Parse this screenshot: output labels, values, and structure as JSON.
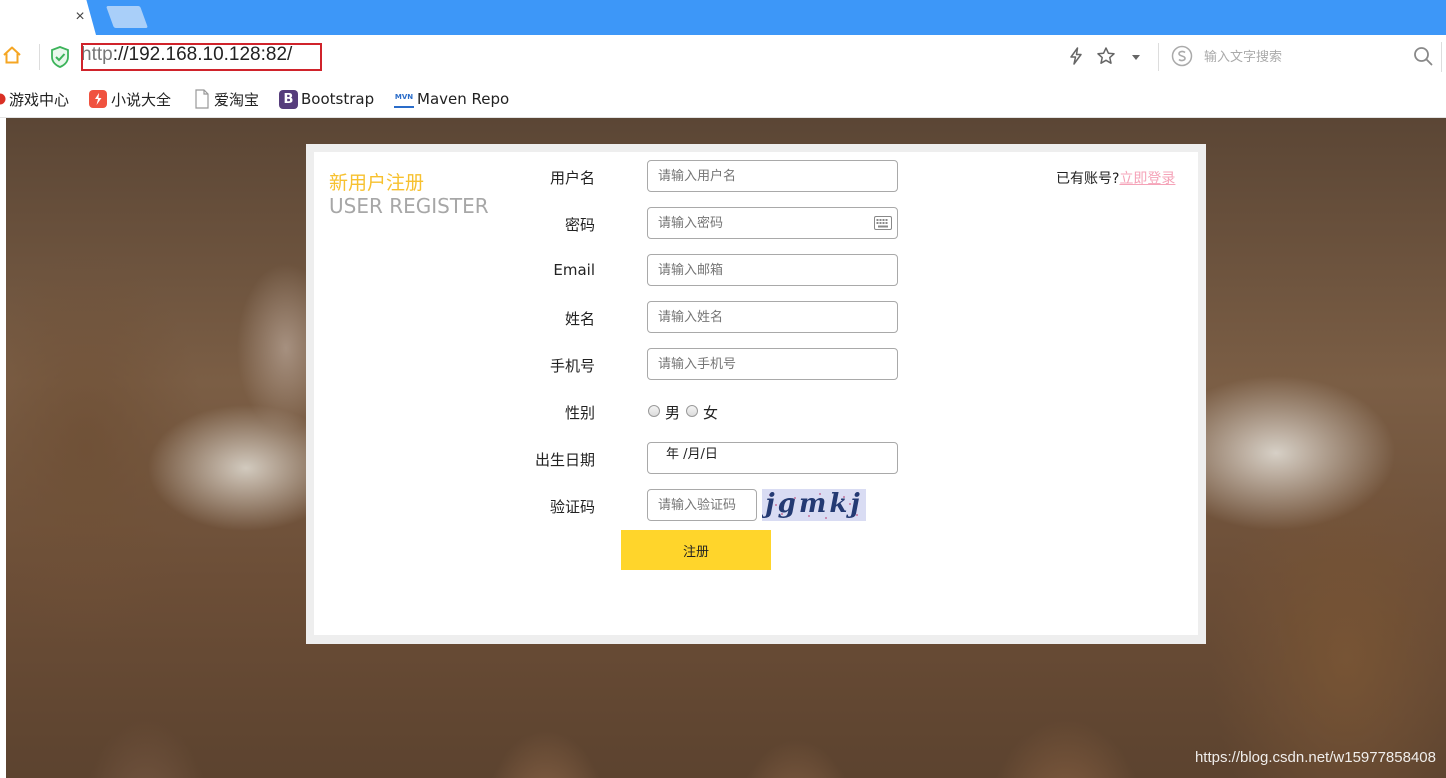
{
  "browser": {
    "tab": {
      "close_glyph": "×"
    },
    "address": {
      "scheme": "http",
      "url_rest": "://192.168.10.128:82/"
    },
    "search": {
      "placeholder": "输入文字搜索"
    },
    "icons": [
      "home-icon",
      "security-shield-icon",
      "lightning-icon",
      "star-icon",
      "chevron-down-icon",
      "sogou-icon",
      "search-icon"
    ],
    "bookmarks": [
      {
        "label": "游戏中心",
        "icon": "game-center-icon"
      },
      {
        "label": "小说大全",
        "icon": "novel-icon"
      },
      {
        "label": "爱淘宝",
        "icon": "page-icon"
      },
      {
        "label": "Bootstrap",
        "icon": "bootstrap-icon",
        "icon_text": "B"
      },
      {
        "label": "Maven Repo",
        "icon": "maven-icon",
        "icon_text": "MVN"
      }
    ]
  },
  "register": {
    "title_cn": "新用户注册",
    "title_en": "USER REGISTER",
    "login_prompt": "已有账号?",
    "login_link": "立即登录",
    "fields": {
      "username": {
        "label": "用户名",
        "placeholder": "请输入用户名"
      },
      "password": {
        "label": "密码",
        "placeholder": "请输入密码"
      },
      "email": {
        "label": "Email",
        "placeholder": "请输入邮箱"
      },
      "name": {
        "label": "姓名",
        "placeholder": "请输入姓名"
      },
      "phone": {
        "label": "手机号",
        "placeholder": "请输入手机号"
      },
      "gender": {
        "label": "性别",
        "options": [
          "男",
          "女"
        ]
      },
      "birthday": {
        "label": "出生日期",
        "value": "年 /月/日"
      },
      "captcha": {
        "label": "验证码",
        "placeholder": "请输入验证码",
        "image_text": "jgmkj"
      }
    },
    "submit_label": "注册"
  },
  "watermark": "https://blog.csdn.net/w15977858408",
  "colors": {
    "tabbar": "#3d97f8",
    "title_accent": "#f7c12f",
    "title_secondary": "#a7a7a7",
    "login_link": "#f5a3b8",
    "submit_button": "#ffd52b",
    "url_highlight_box": "#d0232b"
  }
}
